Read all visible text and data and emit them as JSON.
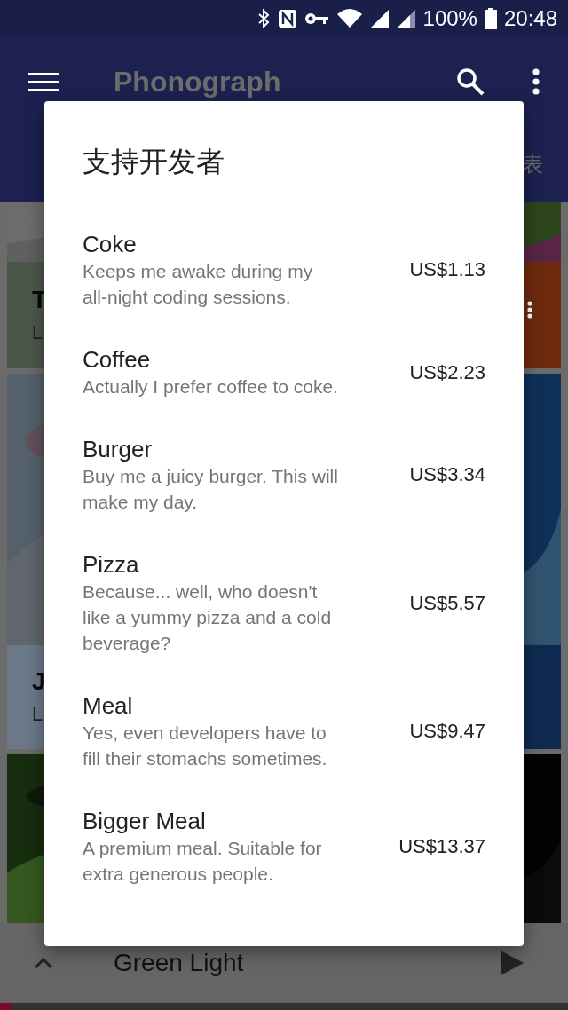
{
  "status_bar": {
    "battery": "100%",
    "time": "20:48"
  },
  "app_bar": {
    "title": "Phonograph"
  },
  "tabs": [
    {
      "label": "表"
    }
  ],
  "cards": [
    {
      "kind": "album",
      "title": "T",
      "subtitle": "L",
      "color": "#4b564a"
    },
    {
      "kind": "album",
      "color": "#6e2a0e",
      "menu": true
    },
    {
      "kind": "album",
      "title": "J",
      "subtitle": "L",
      "color": "#6a7888"
    },
    {
      "kind": "album",
      "color": "#0f2a50"
    },
    {
      "kind": "picture"
    },
    {
      "kind": "picture"
    }
  ],
  "now_playing": {
    "title": "Green Light",
    "level": 0.02
  },
  "dialog": {
    "title": "支持开发者",
    "items": [
      {
        "name": "Coke",
        "description": "Keeps me awake during my all-night coding sessions.",
        "price": "US$1.13"
      },
      {
        "name": "Coffee",
        "description": "Actually I prefer coffee to coke.",
        "price": "US$2.23"
      },
      {
        "name": "Burger",
        "description": "Buy me a juicy burger. This will make my day.",
        "price": "US$3.34"
      },
      {
        "name": "Pizza",
        "description": "Because... well, who doesn't like a yummy pizza and a cold beverage?",
        "price": "US$5.57"
      },
      {
        "name": "Meal",
        "description": "Yes, even developers have to fill their stomachs sometimes.",
        "price": "US$9.47"
      },
      {
        "name": "Bigger Meal",
        "description": "A premium meal. Suitable for extra generous people.",
        "price": "US$13.37"
      }
    ]
  }
}
